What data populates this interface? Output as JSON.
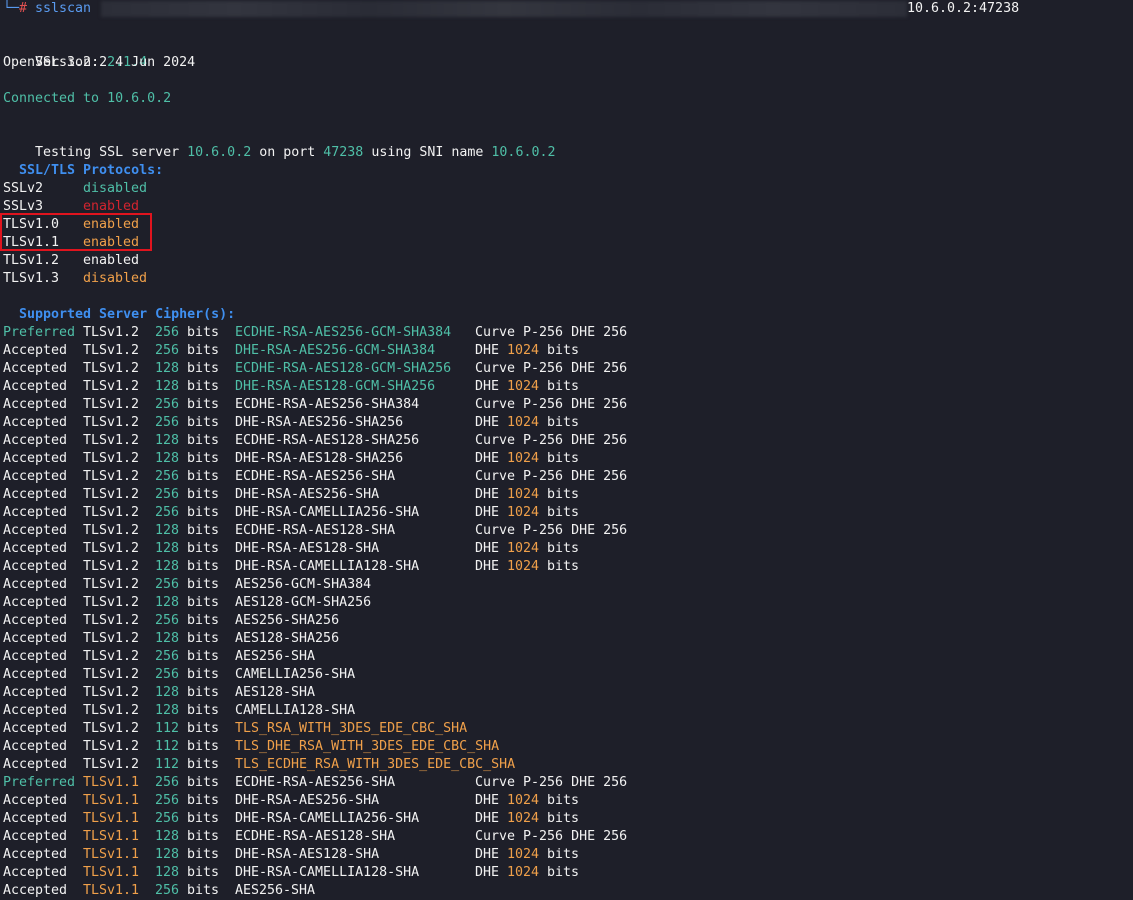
{
  "prompt": {
    "corner": "└─",
    "hash": "#",
    "command": "sslscan",
    "target": "10.6.0.2:47238"
  },
  "header": {
    "version_label": "Version:",
    "version_value": "2.1.4",
    "openssl": "OpenSSL 3.2.2 4 Jun 2024",
    "connected": "Connected to 10.6.0.2",
    "testing_prefix": "Testing SSL server",
    "testing_host": "10.6.0.2",
    "testing_on_port": "on port",
    "testing_port": "47238",
    "testing_sni": "using SNI name",
    "testing_sni_value": "10.6.0.2"
  },
  "protocols": {
    "title": "SSL/TLS Protocols:",
    "items": [
      {
        "name": "SSLv2",
        "status": "disabled",
        "color": "teal"
      },
      {
        "name": "SSLv3",
        "status": "enabled",
        "color": "red"
      },
      {
        "name": "TLSv1.0",
        "status": "enabled",
        "color": "orange"
      },
      {
        "name": "TLSv1.1",
        "status": "enabled",
        "color": "orange"
      },
      {
        "name": "TLSv1.2",
        "status": "enabled",
        "color": "white"
      },
      {
        "name": "TLSv1.3",
        "status": "disabled",
        "color": "orange"
      }
    ]
  },
  "ciphers": {
    "title": "Supported Server Cipher(s):",
    "rows": [
      {
        "status": "Preferred",
        "statusColor": "teal",
        "proto": "TLSv1.2",
        "protoColor": "white",
        "bits": "256",
        "cipher": "ECDHE-RSA-AES256-GCM-SHA384",
        "cipherColor": "teal",
        "kx": "Curve P-256 DHE 256",
        "kxBits": ""
      },
      {
        "status": "Accepted",
        "statusColor": "white",
        "proto": "TLSv1.2",
        "protoColor": "white",
        "bits": "256",
        "cipher": "DHE-RSA-AES256-GCM-SHA384",
        "cipherColor": "teal",
        "kx": "DHE",
        "kxBits": "1024"
      },
      {
        "status": "Accepted",
        "statusColor": "white",
        "proto": "TLSv1.2",
        "protoColor": "white",
        "bits": "128",
        "cipher": "ECDHE-RSA-AES128-GCM-SHA256",
        "cipherColor": "teal",
        "kx": "Curve P-256 DHE 256",
        "kxBits": ""
      },
      {
        "status": "Accepted",
        "statusColor": "white",
        "proto": "TLSv1.2",
        "protoColor": "white",
        "bits": "128",
        "cipher": "DHE-RSA-AES128-GCM-SHA256",
        "cipherColor": "teal",
        "kx": "DHE",
        "kxBits": "1024"
      },
      {
        "status": "Accepted",
        "statusColor": "white",
        "proto": "TLSv1.2",
        "protoColor": "white",
        "bits": "256",
        "cipher": "ECDHE-RSA-AES256-SHA384",
        "cipherColor": "white",
        "kx": "Curve P-256 DHE 256",
        "kxBits": ""
      },
      {
        "status": "Accepted",
        "statusColor": "white",
        "proto": "TLSv1.2",
        "protoColor": "white",
        "bits": "256",
        "cipher": "DHE-RSA-AES256-SHA256",
        "cipherColor": "white",
        "kx": "DHE",
        "kxBits": "1024"
      },
      {
        "status": "Accepted",
        "statusColor": "white",
        "proto": "TLSv1.2",
        "protoColor": "white",
        "bits": "128",
        "cipher": "ECDHE-RSA-AES128-SHA256",
        "cipherColor": "white",
        "kx": "Curve P-256 DHE 256",
        "kxBits": ""
      },
      {
        "status": "Accepted",
        "statusColor": "white",
        "proto": "TLSv1.2",
        "protoColor": "white",
        "bits": "128",
        "cipher": "DHE-RSA-AES128-SHA256",
        "cipherColor": "white",
        "kx": "DHE",
        "kxBits": "1024"
      },
      {
        "status": "Accepted",
        "statusColor": "white",
        "proto": "TLSv1.2",
        "protoColor": "white",
        "bits": "256",
        "cipher": "ECDHE-RSA-AES256-SHA",
        "cipherColor": "white",
        "kx": "Curve P-256 DHE 256",
        "kxBits": ""
      },
      {
        "status": "Accepted",
        "statusColor": "white",
        "proto": "TLSv1.2",
        "protoColor": "white",
        "bits": "256",
        "cipher": "DHE-RSA-AES256-SHA",
        "cipherColor": "white",
        "kx": "DHE",
        "kxBits": "1024"
      },
      {
        "status": "Accepted",
        "statusColor": "white",
        "proto": "TLSv1.2",
        "protoColor": "white",
        "bits": "256",
        "cipher": "DHE-RSA-CAMELLIA256-SHA",
        "cipherColor": "white",
        "kx": "DHE",
        "kxBits": "1024"
      },
      {
        "status": "Accepted",
        "statusColor": "white",
        "proto": "TLSv1.2",
        "protoColor": "white",
        "bits": "128",
        "cipher": "ECDHE-RSA-AES128-SHA",
        "cipherColor": "white",
        "kx": "Curve P-256 DHE 256",
        "kxBits": ""
      },
      {
        "status": "Accepted",
        "statusColor": "white",
        "proto": "TLSv1.2",
        "protoColor": "white",
        "bits": "128",
        "cipher": "DHE-RSA-AES128-SHA",
        "cipherColor": "white",
        "kx": "DHE",
        "kxBits": "1024"
      },
      {
        "status": "Accepted",
        "statusColor": "white",
        "proto": "TLSv1.2",
        "protoColor": "white",
        "bits": "128",
        "cipher": "DHE-RSA-CAMELLIA128-SHA",
        "cipherColor": "white",
        "kx": "DHE",
        "kxBits": "1024"
      },
      {
        "status": "Accepted",
        "statusColor": "white",
        "proto": "TLSv1.2",
        "protoColor": "white",
        "bits": "256",
        "cipher": "AES256-GCM-SHA384",
        "cipherColor": "white",
        "kx": "",
        "kxBits": ""
      },
      {
        "status": "Accepted",
        "statusColor": "white",
        "proto": "TLSv1.2",
        "protoColor": "white",
        "bits": "128",
        "cipher": "AES128-GCM-SHA256",
        "cipherColor": "white",
        "kx": "",
        "kxBits": ""
      },
      {
        "status": "Accepted",
        "statusColor": "white",
        "proto": "TLSv1.2",
        "protoColor": "white",
        "bits": "256",
        "cipher": "AES256-SHA256",
        "cipherColor": "white",
        "kx": "",
        "kxBits": ""
      },
      {
        "status": "Accepted",
        "statusColor": "white",
        "proto": "TLSv1.2",
        "protoColor": "white",
        "bits": "128",
        "cipher": "AES128-SHA256",
        "cipherColor": "white",
        "kx": "",
        "kxBits": ""
      },
      {
        "status": "Accepted",
        "statusColor": "white",
        "proto": "TLSv1.2",
        "protoColor": "white",
        "bits": "256",
        "cipher": "AES256-SHA",
        "cipherColor": "white",
        "kx": "",
        "kxBits": ""
      },
      {
        "status": "Accepted",
        "statusColor": "white",
        "proto": "TLSv1.2",
        "protoColor": "white",
        "bits": "256",
        "cipher": "CAMELLIA256-SHA",
        "cipherColor": "white",
        "kx": "",
        "kxBits": ""
      },
      {
        "status": "Accepted",
        "statusColor": "white",
        "proto": "TLSv1.2",
        "protoColor": "white",
        "bits": "128",
        "cipher": "AES128-SHA",
        "cipherColor": "white",
        "kx": "",
        "kxBits": ""
      },
      {
        "status": "Accepted",
        "statusColor": "white",
        "proto": "TLSv1.2",
        "protoColor": "white",
        "bits": "128",
        "cipher": "CAMELLIA128-SHA",
        "cipherColor": "white",
        "kx": "",
        "kxBits": ""
      },
      {
        "status": "Accepted",
        "statusColor": "white",
        "proto": "TLSv1.2",
        "protoColor": "white",
        "bits": "112",
        "cipher": "TLS_RSA_WITH_3DES_EDE_CBC_SHA",
        "cipherColor": "orange",
        "kx": "",
        "kxBits": ""
      },
      {
        "status": "Accepted",
        "statusColor": "white",
        "proto": "TLSv1.2",
        "protoColor": "white",
        "bits": "112",
        "cipher": "TLS_DHE_RSA_WITH_3DES_EDE_CBC_SHA",
        "cipherColor": "orange",
        "kx": "",
        "kxBits": ""
      },
      {
        "status": "Accepted",
        "statusColor": "white",
        "proto": "TLSv1.2",
        "protoColor": "white",
        "bits": "112",
        "cipher": "TLS_ECDHE_RSA_WITH_3DES_EDE_CBC_SHA",
        "cipherColor": "orange",
        "kx": "",
        "kxBits": ""
      },
      {
        "status": "Preferred",
        "statusColor": "teal",
        "proto": "TLSv1.1",
        "protoColor": "orange",
        "bits": "256",
        "cipher": "ECDHE-RSA-AES256-SHA",
        "cipherColor": "white",
        "kx": "Curve P-256 DHE 256",
        "kxBits": ""
      },
      {
        "status": "Accepted",
        "statusColor": "white",
        "proto": "TLSv1.1",
        "protoColor": "orange",
        "bits": "256",
        "cipher": "DHE-RSA-AES256-SHA",
        "cipherColor": "white",
        "kx": "DHE",
        "kxBits": "1024"
      },
      {
        "status": "Accepted",
        "statusColor": "white",
        "proto": "TLSv1.1",
        "protoColor": "orange",
        "bits": "256",
        "cipher": "DHE-RSA-CAMELLIA256-SHA",
        "cipherColor": "white",
        "kx": "DHE",
        "kxBits": "1024"
      },
      {
        "status": "Accepted",
        "statusColor": "white",
        "proto": "TLSv1.1",
        "protoColor": "orange",
        "bits": "128",
        "cipher": "ECDHE-RSA-AES128-SHA",
        "cipherColor": "white",
        "kx": "Curve P-256 DHE 256",
        "kxBits": ""
      },
      {
        "status": "Accepted",
        "statusColor": "white",
        "proto": "TLSv1.1",
        "protoColor": "orange",
        "bits": "128",
        "cipher": "DHE-RSA-AES128-SHA",
        "cipherColor": "white",
        "kx": "DHE",
        "kxBits": "1024"
      },
      {
        "status": "Accepted",
        "statusColor": "white",
        "proto": "TLSv1.1",
        "protoColor": "orange",
        "bits": "128",
        "cipher": "DHE-RSA-CAMELLIA128-SHA",
        "cipherColor": "white",
        "kx": "DHE",
        "kxBits": "1024"
      },
      {
        "status": "Accepted",
        "statusColor": "white",
        "proto": "TLSv1.1",
        "protoColor": "orange",
        "bits": "256",
        "cipher": "AES256-SHA",
        "cipherColor": "white",
        "kx": "",
        "kxBits": ""
      }
    ],
    "bits_suffix": "bits"
  }
}
